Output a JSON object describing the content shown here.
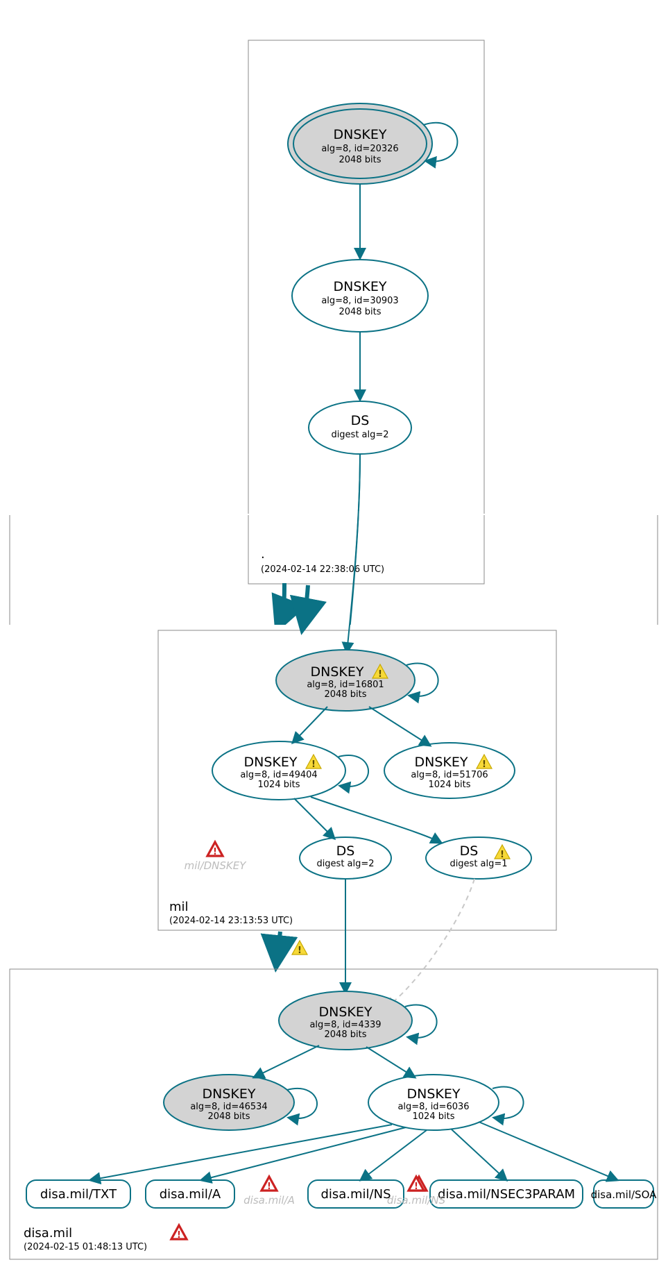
{
  "colors": {
    "stroke": "#0b7285",
    "fill_sep": "#d3d3d3"
  },
  "zones": {
    "root": {
      "label": ".",
      "timestamp": "(2024-02-14 22:38:06 UTC)"
    },
    "mil": {
      "label": "mil",
      "timestamp": "(2024-02-14 23:13:53 UTC)"
    },
    "disa": {
      "label": "disa.mil",
      "timestamp": "(2024-02-15 01:48:13 UTC)"
    }
  },
  "nodes": {
    "root_ksk": {
      "title": "DNSKEY",
      "l1": "alg=8, id=20326",
      "l2": "2048 bits"
    },
    "root_zsk": {
      "title": "DNSKEY",
      "l1": "alg=8, id=30903",
      "l2": "2048 bits"
    },
    "root_ds": {
      "title": "DS",
      "l1": "digest alg=2",
      "l2": ""
    },
    "mil_ksk": {
      "title": "DNSKEY",
      "l1": "alg=8, id=16801",
      "l2": "2048 bits"
    },
    "mil_zsk1": {
      "title": "DNSKEY",
      "l1": "alg=8, id=49404",
      "l2": "1024 bits"
    },
    "mil_zsk2": {
      "title": "DNSKEY",
      "l1": "alg=8, id=51706",
      "l2": "1024 bits"
    },
    "mil_ds1": {
      "title": "DS",
      "l1": "digest alg=2",
      "l2": ""
    },
    "mil_ds2": {
      "title": "DS",
      "l1": "digest alg=1",
      "l2": ""
    },
    "disa_ksk": {
      "title": "DNSKEY",
      "l1": "alg=8, id=4339",
      "l2": "2048 bits"
    },
    "disa_k2": {
      "title": "DNSKEY",
      "l1": "alg=8, id=46534",
      "l2": "2048 bits"
    },
    "disa_zsk": {
      "title": "DNSKEY",
      "l1": "alg=8, id=6036",
      "l2": "1024 bits"
    }
  },
  "records": {
    "txt": "disa.mil/TXT",
    "a": "disa.mil/A",
    "ns": "disa.mil/NS",
    "n3p": "disa.mil/NSEC3PARAM",
    "soa": "disa.mil/SOA"
  },
  "faded": {
    "mil_dnskey": "mil/DNSKEY",
    "disa_a": "disa.mil/A",
    "disa_ns": "disa.mil/NS"
  },
  "chart_data": {
    "type": "dnssec-authentication-graph",
    "zones": [
      {
        "name": ".",
        "analyzed_at": "2024-02-14 22:38:06 UTC",
        "keys": [
          {
            "id": 20326,
            "alg": 8,
            "bits": 2048,
            "role": "KSK",
            "trust_anchor": true,
            "self_signed": true
          },
          {
            "id": 30903,
            "alg": 8,
            "bits": 2048,
            "role": "ZSK"
          }
        ],
        "ds_for_child": [
          {
            "digest_alg": 2
          }
        ]
      },
      {
        "name": "mil",
        "analyzed_at": "2024-02-14 23:13:53 UTC",
        "keys": [
          {
            "id": 16801,
            "alg": 8,
            "bits": 2048,
            "role": "KSK",
            "status": "warning",
            "self_signed": true
          },
          {
            "id": 49404,
            "alg": 8,
            "bits": 1024,
            "role": "ZSK",
            "status": "warning",
            "self_signed": true
          },
          {
            "id": 51706,
            "alg": 8,
            "bits": 1024,
            "role": "ZSK",
            "status": "warning"
          }
        ],
        "ds_for_child": [
          {
            "digest_alg": 2
          },
          {
            "digest_alg": 1,
            "status": "warning"
          }
        ],
        "errors": [
          "mil/DNSKEY"
        ]
      },
      {
        "name": "disa.mil",
        "analyzed_at": "2024-02-15 01:48:13 UTC",
        "zone_status": "error",
        "keys": [
          {
            "id": 4339,
            "alg": 8,
            "bits": 2048,
            "role": "KSK",
            "self_signed": true
          },
          {
            "id": 46534,
            "alg": 8,
            "bits": 2048,
            "role": "KSK-standby",
            "self_signed": true
          },
          {
            "id": 6036,
            "alg": 8,
            "bits": 1024,
            "role": "ZSK",
            "self_signed": true
          }
        ],
        "rrsets": [
          "disa.mil/TXT",
          "disa.mil/A",
          "disa.mil/NS",
          "disa.mil/NSEC3PARAM",
          "disa.mil/SOA"
        ],
        "errors": [
          "disa.mil/A",
          "disa.mil/NS"
        ]
      }
    ],
    "delegations": [
      {
        "from": ".",
        "to": "mil",
        "status": "secure"
      },
      {
        "from": "mil",
        "to": "disa.mil",
        "status": "warning"
      }
    ],
    "signs": [
      {
        "signer": ".-20326",
        "target": ".-20326"
      },
      {
        "signer": ".-20326",
        "target": ".-30903"
      },
      {
        "signer": ".-30903",
        "target": "DS(mil,alg2)"
      },
      {
        "signer": "DS(mil,alg2)",
        "target": "mil-16801"
      },
      {
        "signer": "mil-16801",
        "target": "mil-16801"
      },
      {
        "signer": "mil-16801",
        "target": "mil-49404"
      },
      {
        "signer": "mil-16801",
        "target": "mil-51706"
      },
      {
        "signer": "mil-49404",
        "target": "mil-49404"
      },
      {
        "signer": "mil-49404",
        "target": "DS(disa,alg2)"
      },
      {
        "signer": "mil-49404",
        "target": "DS(disa,alg1)"
      },
      {
        "signer": "DS(disa,alg2)",
        "target": "disa-4339"
      },
      {
        "signer": "DS(disa,alg1)",
        "target": "disa-4339",
        "status": "insecure"
      },
      {
        "signer": "disa-4339",
        "target": "disa-4339"
      },
      {
        "signer": "disa-4339",
        "target": "disa-46534"
      },
      {
        "signer": "disa-4339",
        "target": "disa-6036"
      },
      {
        "signer": "disa-46534",
        "target": "disa-46534"
      },
      {
        "signer": "disa-6036",
        "target": "disa-6036"
      },
      {
        "signer": "disa-6036",
        "target": "disa.mil/TXT"
      },
      {
        "signer": "disa-6036",
        "target": "disa.mil/A"
      },
      {
        "signer": "disa-6036",
        "target": "disa.mil/NS"
      },
      {
        "signer": "disa-6036",
        "target": "disa.mil/NSEC3PARAM"
      },
      {
        "signer": "disa-6036",
        "target": "disa.mil/SOA"
      }
    ]
  }
}
